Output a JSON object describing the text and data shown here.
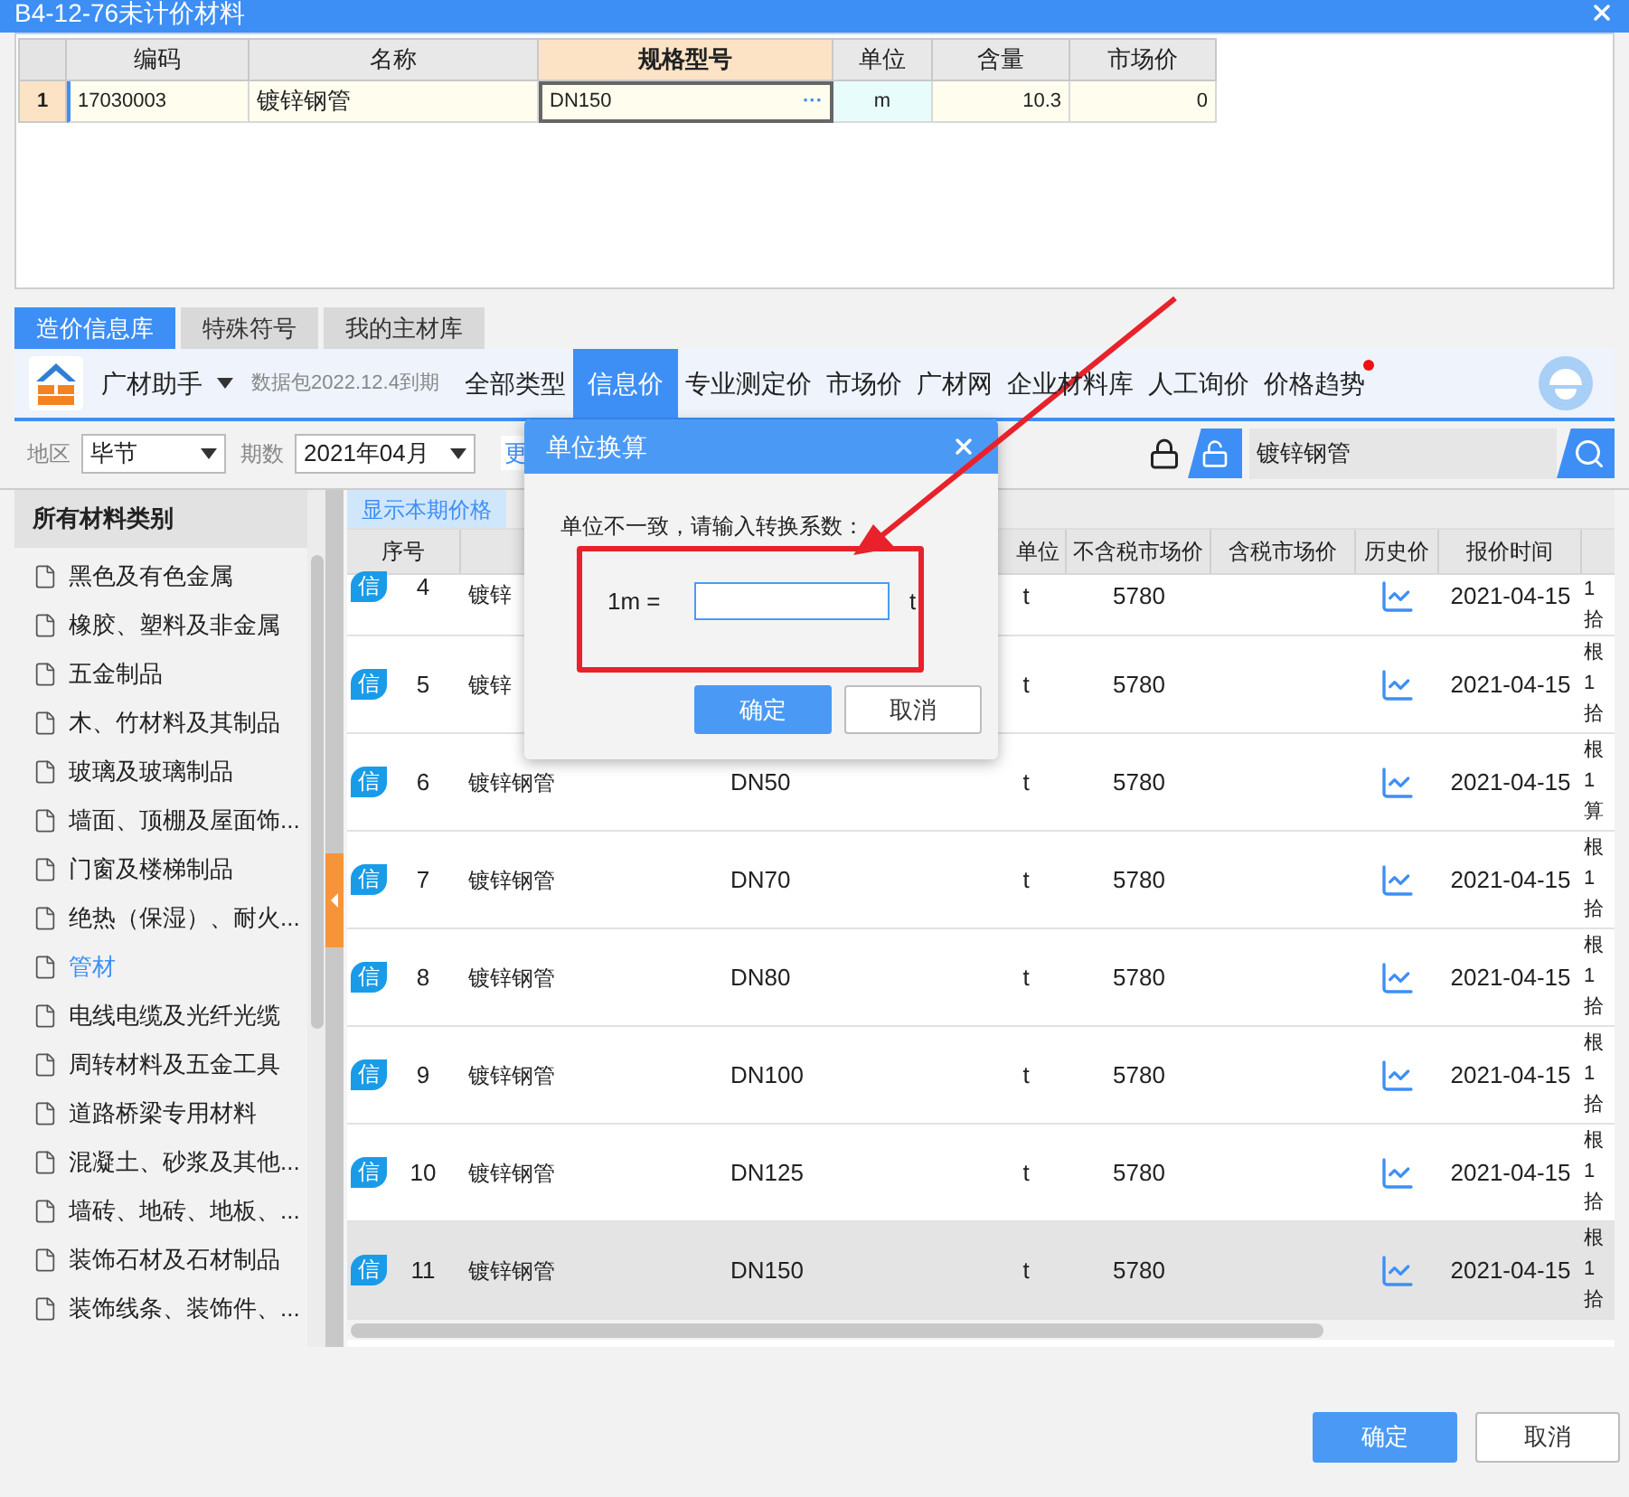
{
  "window": {
    "title": "B4-12-76未计价材料"
  },
  "material_table": {
    "columns": [
      {
        "label": "编码",
        "selected": false
      },
      {
        "label": "名称",
        "selected": false
      },
      {
        "label": "规格型号",
        "selected": true
      },
      {
        "label": "单位",
        "selected": false
      },
      {
        "label": "含量",
        "selected": false
      },
      {
        "label": "市场价",
        "selected": false
      }
    ],
    "rows": [
      {
        "index": "1",
        "selected": true,
        "cells": [
          "17030003",
          "镀锌钢管",
          "DN150",
          "m",
          "10.3",
          "0"
        ],
        "ellipsis": "···"
      }
    ]
  },
  "tabs": [
    {
      "label": "造价信息库",
      "selected": true
    },
    {
      "label": "特殊符号",
      "selected": false
    },
    {
      "label": "我的主材库",
      "selected": false
    }
  ],
  "toolbar": {
    "brand": "广材助手",
    "package": "数据包2022.12.4到期",
    "nav": [
      {
        "label": "全部类型",
        "selected": false,
        "notify": false
      },
      {
        "label": "信息价",
        "selected": true,
        "notify": false
      },
      {
        "label": "专业测定价",
        "selected": false,
        "notify": false
      },
      {
        "label": "市场价",
        "selected": false,
        "notify": false
      },
      {
        "label": "广材网",
        "selected": false,
        "notify": false
      },
      {
        "label": "企业材料库",
        "selected": false,
        "notify": false
      },
      {
        "label": "人工询价",
        "selected": false,
        "notify": false
      },
      {
        "label": "价格趋势",
        "selected": false,
        "notify": true
      }
    ]
  },
  "filters": {
    "region_label": "地区",
    "region": "毕节",
    "period_label": "期数",
    "period": "2021年04月",
    "more_link": "更",
    "search": {
      "value": "镀锌钢管"
    }
  },
  "sidebar": {
    "title": "所有材料类别",
    "items": [
      {
        "label": "黑色及有色金属",
        "selected": false
      },
      {
        "label": "橡胶、塑料及非金属",
        "selected": false
      },
      {
        "label": "五金制品",
        "selected": false
      },
      {
        "label": "木、竹材料及其制品",
        "selected": false
      },
      {
        "label": "玻璃及玻璃制品",
        "selected": false
      },
      {
        "label": "墙面、顶棚及屋面饰...",
        "selected": false
      },
      {
        "label": "门窗及楼梯制品",
        "selected": false
      },
      {
        "label": "绝热（保湿）、耐火...",
        "selected": false
      },
      {
        "label": "管材",
        "selected": true
      },
      {
        "label": "电线电缆及光纤光缆",
        "selected": false
      },
      {
        "label": "周转材料及五金工具",
        "selected": false
      },
      {
        "label": "道路桥梁专用材料",
        "selected": false
      },
      {
        "label": "混凝土、砂浆及其他...",
        "selected": false
      },
      {
        "label": "墙砖、地砖、地板、...",
        "selected": false
      },
      {
        "label": "装饰石材及石材制品",
        "selected": false
      },
      {
        "label": "装饰线条、装饰件、...",
        "selected": false
      }
    ]
  },
  "price_table": {
    "filter_tab": "显示本期价格",
    "header": {
      "index": "序号",
      "unit": "单位",
      "price_ex_tax": "不含税市场价",
      "price_inc_tax": "含税市场价",
      "history": "历史价",
      "date": "报价时间"
    },
    "rows": [
      {
        "badge": "信",
        "no": "4",
        "name": "镀锌",
        "unit": "t",
        "price": "5780",
        "date": "2021-04-15",
        "column_10": [
          "1",
          "拾"
        ],
        "selected": false
      },
      {
        "badge": "信",
        "no": "5",
        "name": "镀锌",
        "unit": "t",
        "price": "5780",
        "date": "2021-04-15",
        "column_10": [
          "根",
          "1",
          "拾"
        ],
        "selected": false
      },
      {
        "badge": "信",
        "no": "6",
        "name": "镀锌钢管",
        "spec": "DN50",
        "unit": "t",
        "price": "5780",
        "date": "2021-04-15",
        "column_10": [
          "根",
          "1",
          "算"
        ],
        "selected": false
      },
      {
        "badge": "信",
        "no": "7",
        "name": "镀锌钢管",
        "spec": "DN70",
        "unit": "t",
        "price": "5780",
        "date": "2021-04-15",
        "column_10": [
          "根",
          "1",
          "拾"
        ],
        "selected": false
      },
      {
        "badge": "信",
        "no": "8",
        "name": "镀锌钢管",
        "spec": "DN80",
        "unit": "t",
        "price": "5780",
        "date": "2021-04-15",
        "column_10": [
          "根",
          "1",
          "拾"
        ],
        "selected": false
      },
      {
        "badge": "信",
        "no": "9",
        "name": "镀锌钢管",
        "spec": "DN100",
        "unit": "t",
        "price": "5780",
        "date": "2021-04-15",
        "column_10": [
          "根",
          "1",
          "拾"
        ],
        "selected": false
      },
      {
        "badge": "信",
        "no": "10",
        "name": "镀锌钢管",
        "spec": "DN125",
        "unit": "t",
        "price": "5780",
        "date": "2021-04-15",
        "column_10": [
          "根",
          "1",
          "拾"
        ],
        "selected": false
      },
      {
        "badge": "信",
        "no": "11",
        "name": "镀锌钢管",
        "spec": "DN150",
        "unit": "t",
        "price": "5780",
        "date": "2021-04-15",
        "column_10": [
          "根",
          "1",
          "拾"
        ],
        "selected": true
      }
    ]
  },
  "dialog": {
    "title": "单位换算",
    "message": "单位不一致，请输入转换系数：",
    "label": "1m =",
    "unit": "t",
    "buttons": [
      {
        "label": "确定",
        "primary": true
      },
      {
        "label": "取消",
        "primary": false
      }
    ]
  },
  "footer": {
    "buttons": [
      {
        "label": "确定",
        "primary": true
      },
      {
        "label": "取消",
        "primary": false
      }
    ]
  }
}
